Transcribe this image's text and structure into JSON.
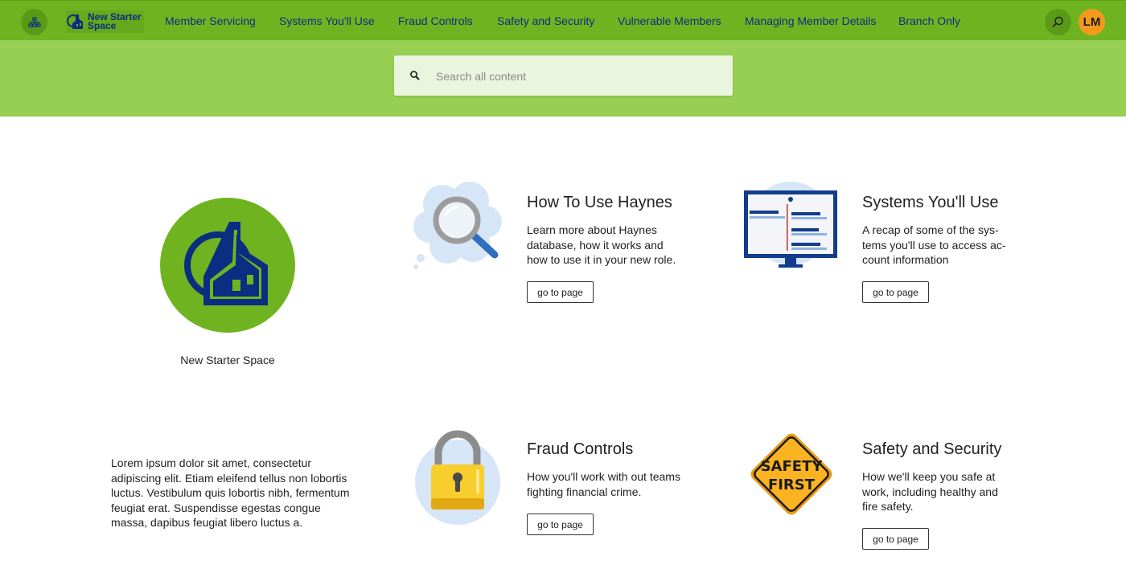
{
  "header": {
    "logo_line1": "New Starter",
    "logo_line2": "Space",
    "nav": [
      {
        "label": "Member Servicing"
      },
      {
        "label": "Systems You'll Use"
      },
      {
        "label": "Fraud Controls"
      },
      {
        "label": "Safety and Security"
      },
      {
        "label": "Vulnerable Members"
      },
      {
        "label": "Managing Member Details"
      },
      {
        "label": "Branch Only"
      }
    ],
    "avatar_initials": "LM",
    "colors": {
      "bar": "#6fb420",
      "nav_text": "#0b2e82",
      "avatar": "#f39a1e"
    }
  },
  "search": {
    "placeholder": "Search all content",
    "value": "",
    "icon": "magnifier-icon"
  },
  "hero": {
    "label": "New Starter Space",
    "icon": "house-logo-icon"
  },
  "intro": {
    "text": "Lorem ipsum dolor sit amet, consectetur adipiscing elit. Etiam eleifend tellus non lobortis luctus. Vestibulum quis lobortis nibh, fermentum feugiat erat. Suspendisse egestas congue massa, dapibus feugiat libero luctus a."
  },
  "cards": [
    {
      "title": "How To Use Haynes",
      "description": "Learn more about Haynes database, how it works and how to use it in your new role.",
      "button": "go to page",
      "icon": "magnifier-cloud-icon"
    },
    {
      "title": "Systems You'll Use",
      "description": "A recap of some of the sys-tems you'll use to access ac-count information",
      "button": "go to page",
      "icon": "monitor-icon"
    },
    {
      "title": "Fraud Controls",
      "description": "How you'll work with out teams fighting financial crime.",
      "button": "go to page",
      "icon": "padlock-icon"
    },
    {
      "title": "Safety and Security",
      "description": "How we'll keep you safe at work, including healthy and fire safety.",
      "button": "go to page",
      "icon": "safety-sign-icon",
      "sign_line1": "SAFETY",
      "sign_line2": "FIRST"
    }
  ]
}
